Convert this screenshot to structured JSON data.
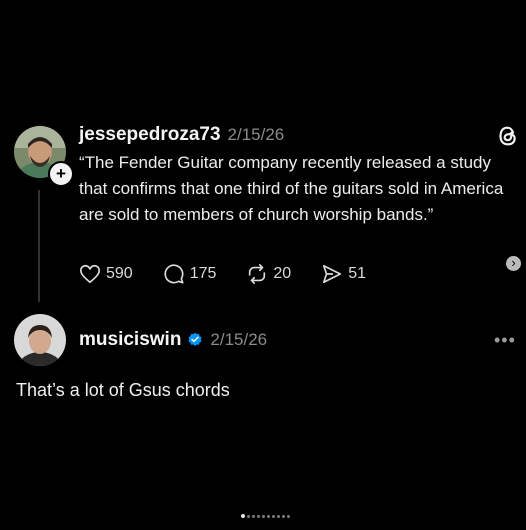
{
  "post": {
    "username": "jessepedroza73",
    "date": "2/15/26",
    "text": "“The Fender Guitar company recently released a study that confirms that one third of the guitars sold in America are sold to members of church worship bands.”",
    "likes": "590",
    "comments": "175",
    "reposts": "20",
    "shares": "51",
    "follow_symbol": "+"
  },
  "reply": {
    "username": "musiciswin",
    "date": "2/15/26",
    "text": "That’s a lot of Gsus chords",
    "more_symbol": "•••"
  },
  "ui": {
    "chevron_symbol": "›",
    "icons": [
      "threads-logo-icon",
      "heart-icon",
      "comment-icon",
      "repost-icon",
      "share-icon",
      "verified-badge-icon",
      "more-options-icon",
      "chevron-right-icon"
    ],
    "accent_color": "#0095f6",
    "background_color": "#000000"
  }
}
